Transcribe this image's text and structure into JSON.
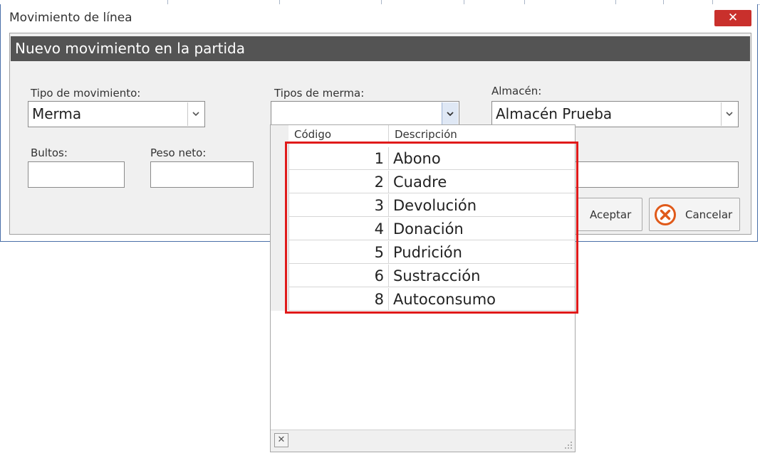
{
  "window": {
    "title": "Movimiento de línea",
    "close_glyph": "✕"
  },
  "panel": {
    "header": "Nuevo movimiento en la partida"
  },
  "fields": {
    "tipo_movimiento": {
      "label": "Tipo de movimiento:",
      "value": "Merma"
    },
    "tipos_merma": {
      "label": "Tipos de merma:",
      "value": ""
    },
    "almacen": {
      "label": "Almacén:",
      "value": "Almacén Prueba"
    },
    "bultos": {
      "label": "Bultos:",
      "value": ""
    },
    "peso_neto": {
      "label": "Peso neto:",
      "value": ""
    }
  },
  "buttons": {
    "aceptar": "Aceptar",
    "cancelar": "Cancelar"
  },
  "dropdown": {
    "columns": [
      "Código",
      "Descripción"
    ],
    "rows": [
      {
        "code": "1",
        "desc": "Abono"
      },
      {
        "code": "2",
        "desc": "Cuadre"
      },
      {
        "code": "3",
        "desc": "Devolución"
      },
      {
        "code": "4",
        "desc": "Donación"
      },
      {
        "code": "5",
        "desc": "Pudrición"
      },
      {
        "code": "6",
        "desc": "Sustracción"
      },
      {
        "code": "8",
        "desc": "Autoconsumo"
      }
    ],
    "clear_glyph": "✕"
  },
  "colors": {
    "highlight": "#e01a1a",
    "close_button": "#c9302c",
    "cancel_icon": "#e05a1a",
    "header_bar": "#545454"
  }
}
